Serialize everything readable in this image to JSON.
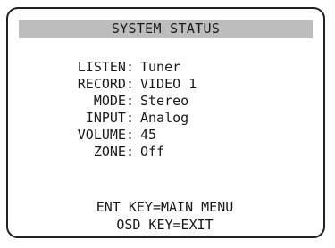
{
  "screen": {
    "title": "SYSTEM STATUS"
  },
  "status": [
    {
      "label": "LISTEN:",
      "value": "Tuner"
    },
    {
      "label": "RECORD:",
      "value": "VIDEO 1"
    },
    {
      "label": "MODE:",
      "value": "Stereo"
    },
    {
      "label": "INPUT:",
      "value": "Analog"
    },
    {
      "label": "VOLUME:",
      "value": "45"
    },
    {
      "label": "ZONE:",
      "value": "Off"
    }
  ],
  "footer": {
    "line1": "ENT KEY=MAIN MENU",
    "line2": "OSD KEY=EXIT"
  },
  "colors": {
    "frame": "#222222",
    "title_bar": "#bdbdbd",
    "text": "#1a1a1a",
    "background": "#ffffff"
  }
}
